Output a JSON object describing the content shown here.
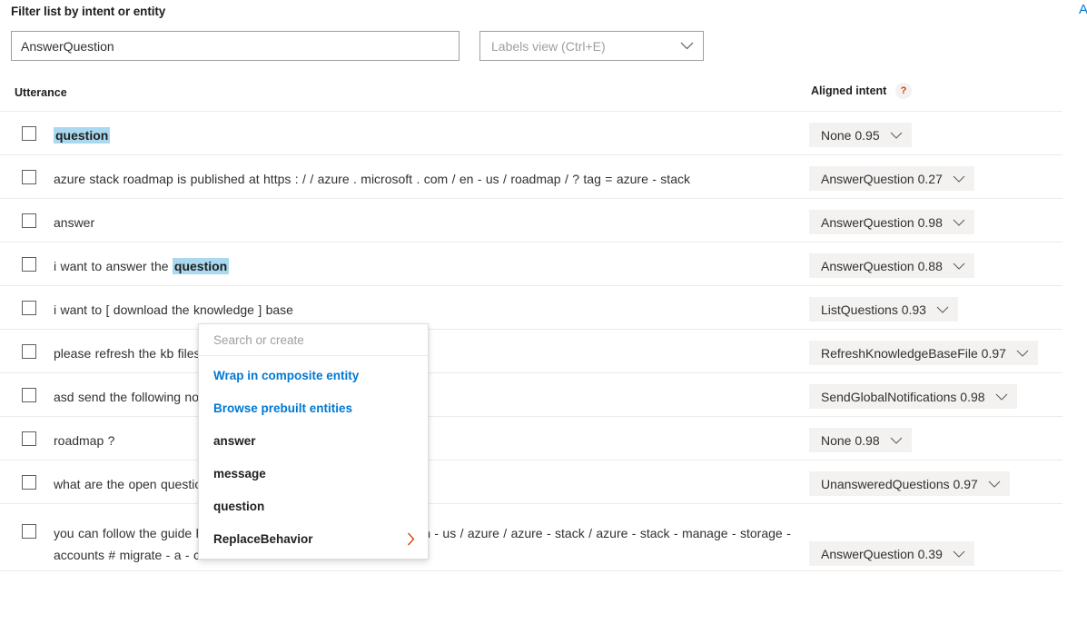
{
  "filter": {
    "title": "Filter list by intent or entity",
    "input_value": "AnswerQuestion",
    "input_placeholder": "Filter list by intent or entity"
  },
  "labels_view": {
    "label": "Labels view (Ctrl+E)",
    "chevron_icon": "chevron-down-icon"
  },
  "corner": {
    "letter": "A"
  },
  "table": {
    "columns": {
      "utterance": "Utterance",
      "aligned_intent": "Aligned intent",
      "help": "?"
    },
    "rows": [
      {
        "checked": false,
        "segments": [
          {
            "text": "question",
            "highlight": true
          }
        ],
        "intent": "None 0.95",
        "tall": false
      },
      {
        "checked": false,
        "segments": [
          {
            "text": "azure stack roadmap is published at https : / / azure . microsoft . com / en - us / roadmap / ? tag = azure - stack",
            "highlight": false
          }
        ],
        "intent": "AnswerQuestion 0.27",
        "tall": false
      },
      {
        "checked": false,
        "segments": [
          {
            "text": "answer",
            "highlight": false
          }
        ],
        "intent": "AnswerQuestion 0.98",
        "tall": false
      },
      {
        "checked": false,
        "segments": [
          {
            "text": "i want to answer the ",
            "highlight": false
          },
          {
            "text": "question",
            "highlight": true
          }
        ],
        "intent": "AnswerQuestion 0.88",
        "tall": false
      },
      {
        "checked": false,
        "segments": [
          {
            "text": "i want to [ download the knowledge ] base",
            "highlight": false
          }
        ],
        "intent": "ListQuestions 0.93",
        "tall": false
      },
      {
        "checked": false,
        "segments": [
          {
            "text": "please refresh the kb files",
            "highlight": false
          }
        ],
        "intent": "RefreshKnowledgeBaseFile 0.97",
        "tall": false
      },
      {
        "checked": false,
        "segments": [
          {
            "text": "asd send the following notification",
            "highlight": false
          }
        ],
        "intent": "SendGlobalNotifications 0.98",
        "tall": false
      },
      {
        "checked": false,
        "segments": [
          {
            "text": "roadmap ?",
            "highlight": false
          }
        ],
        "intent": "None 0.98",
        "tall": false
      },
      {
        "checked": false,
        "segments": [
          {
            "text": "what are the open questions",
            "highlight": false
          }
        ],
        "intent": "UnansweredQuestions 0.97",
        "tall": false
      },
      {
        "checked": false,
        "segments": [
          {
            "text": "you can follow the guide here https : / / docs . microsoft . com / en - us / azure / azure - stack / azure - stack - manage - storage - accounts # migrate - a - content",
            "highlight": false
          }
        ],
        "intent": "AnswerQuestion 0.39",
        "tall": true
      }
    ]
  },
  "popup": {
    "search_placeholder": "Search or create",
    "search_value": "",
    "items": [
      {
        "label": "Wrap in composite entity",
        "style": "link",
        "submenu": false
      },
      {
        "label": "Browse prebuilt entities",
        "style": "link",
        "submenu": false
      },
      {
        "label": "answer",
        "style": "normal",
        "submenu": false
      },
      {
        "label": "message",
        "style": "normal",
        "submenu": false
      },
      {
        "label": "question",
        "style": "normal",
        "submenu": false
      },
      {
        "label": "ReplaceBehavior",
        "style": "normal",
        "submenu": true
      }
    ]
  },
  "colors": {
    "highlight": "#a9d8ef",
    "link": "#0078d4",
    "pill_bg": "#f3f2f1",
    "border": "#edebe9"
  }
}
